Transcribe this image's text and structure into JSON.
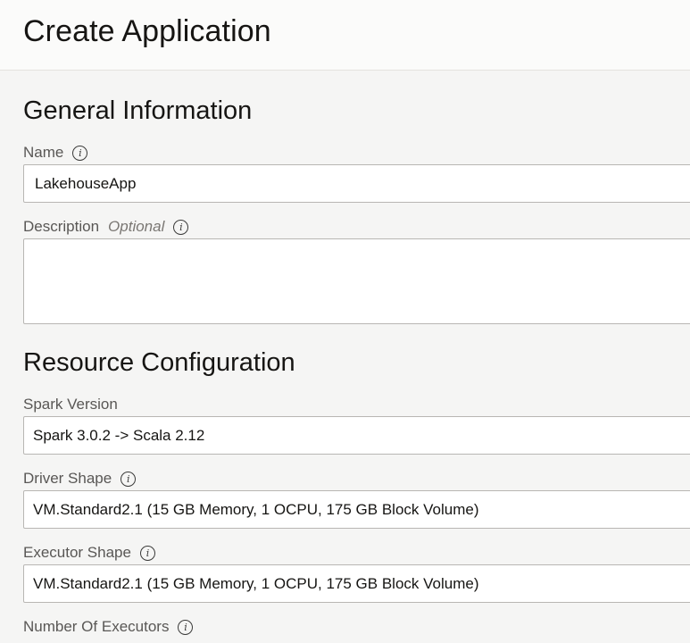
{
  "header": {
    "title": "Create Application"
  },
  "general": {
    "title": "General Information",
    "name": {
      "label": "Name",
      "value": "LakehouseApp"
    },
    "description": {
      "label": "Description",
      "optional": "Optional",
      "value": ""
    }
  },
  "resource": {
    "title": "Resource Configuration",
    "spark_version": {
      "label": "Spark Version",
      "value": "Spark 3.0.2 -> Scala 2.12"
    },
    "driver_shape": {
      "label": "Driver Shape",
      "value": "VM.Standard2.1 (15 GB Memory, 1 OCPU, 175 GB Block Volume)"
    },
    "executor_shape": {
      "label": "Executor Shape",
      "value": "VM.Standard2.1 (15 GB Memory, 1 OCPU, 175 GB Block Volume)"
    },
    "num_executors": {
      "label": "Number Of Executors"
    }
  },
  "icons": {
    "info": "info-icon",
    "info_glyph": "i"
  }
}
